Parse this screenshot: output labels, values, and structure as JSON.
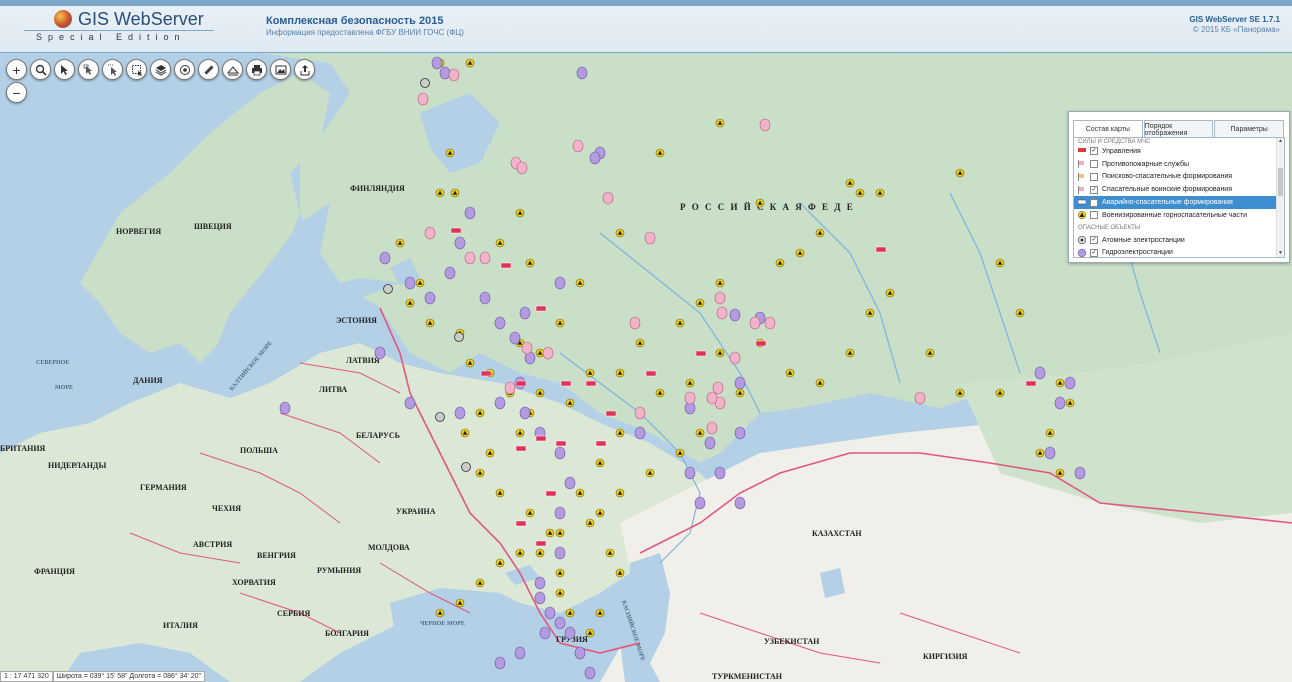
{
  "header": {
    "logo_title": "GIS WebServer",
    "logo_edition": "Special Edition",
    "center_title": "Комплексная безопасность 2015",
    "center_subtitle": "Информация предоставлена ФГБУ ВНИИ ГОЧС (ФЦ)",
    "right_title": "GIS WebServer SE 1.7.1",
    "right_subtitle": "© 2015 КБ «Панорама»"
  },
  "toolbar": {
    "buttons": [
      "zoom-in",
      "search",
      "select-pointer",
      "select-arrow",
      "select-area",
      "select-rect",
      "layers",
      "target",
      "ruler",
      "measure-area",
      "print",
      "export-image",
      "share"
    ],
    "zoom_in": "+",
    "zoom_out": "−"
  },
  "legend": {
    "tabs": [
      "Состав карты",
      "Порядок отображения",
      "Параметры"
    ],
    "active_tab": "Состав карты",
    "partial_top": "СИЛЫ И СРЕДСТВА МЧС",
    "rows": [
      {
        "label": "Управления",
        "checked": true,
        "icon": "flag-red-icon"
      },
      {
        "label": "Противопожарные службы",
        "checked": false,
        "icon": "flag-pink-icon"
      },
      {
        "label": "Поисково-спасательные формирования",
        "checked": false,
        "icon": "flag-orange-icon"
      },
      {
        "label": "Спасательные воинские формирования",
        "checked": true,
        "icon": "flag-pink-icon"
      },
      {
        "label": "Аварийно-спасательные формирования",
        "checked": false,
        "icon": "flag-white-icon",
        "selected": true
      },
      {
        "label": "Военизированные горноспасательные части",
        "checked": false,
        "icon": "warning-triangle-icon"
      }
    ],
    "section2": "ОПАСНЫЕ ОБЪЕКТЫ",
    "rows2": [
      {
        "label": "Атомные электростанции",
        "checked": true,
        "icon": "nuclear-icon"
      },
      {
        "label": "Гидроэлектростанции",
        "checked": true,
        "icon": "hydro-icon"
      }
    ]
  },
  "map_labels": [
    {
      "text": "ФИНЛЯНДИЯ"
    },
    {
      "text": "НОРВЕГИЯ"
    },
    {
      "text": "ШВЕЦИЯ"
    },
    {
      "text": "ЭСТОНИЯ"
    },
    {
      "text": "ЛАТВИЯ"
    },
    {
      "text": "ЛИТВА"
    },
    {
      "text": "ДАНИЯ"
    },
    {
      "text": "БЕЛАРУСЬ"
    },
    {
      "text": "ПОЛЬША"
    },
    {
      "text": "ГЕРМАНИЯ"
    },
    {
      "text": "НИДЕРЛАНДЫ"
    },
    {
      "text": "БРИТАНИЯ"
    },
    {
      "text": "ЧЕХИЯ"
    },
    {
      "text": "АВСТРИЯ"
    },
    {
      "text": "ВЕНГРИЯ"
    },
    {
      "text": "УКРАИНА"
    },
    {
      "text": "МОЛДОВА"
    },
    {
      "text": "РУМЫНИЯ"
    },
    {
      "text": "ФРАНЦИЯ"
    },
    {
      "text": "ХОРВАТИЯ"
    },
    {
      "text": "СЕРБИЯ"
    },
    {
      "text": "ИТАЛИЯ"
    },
    {
      "text": "БОЛГАРИЯ"
    },
    {
      "text": "ГРУЗИЯ"
    },
    {
      "text": "КАЗАХСТАН"
    },
    {
      "text": "УЗБЕКИСТАН"
    },
    {
      "text": "ТУРКМЕНИСТАН"
    },
    {
      "text": "КИРГИЗИЯ"
    },
    {
      "text": "Р О С С И Й С К А Я   Ф Е Д Е"
    },
    {
      "text": "СЕВЕРНОЕ"
    },
    {
      "text": "МОРЕ"
    },
    {
      "text": "ЧЕРНОЕ МОРЕ"
    },
    {
      "text": "КАСПИЙСКОЕ МОРЕ"
    },
    {
      "text": "БАЛТИЙСКОЕ МОРЕ"
    }
  ],
  "status": {
    "scale": "1 : 17 471 320",
    "coords": "Широта = 039° 15' 58\" Долгота = 086° 34' 20\""
  },
  "colors": {
    "sea": "#b3d0e6",
    "land_green": "#c9dfc7",
    "land_beige": "#f1efe9",
    "border_pink": "#e0577f",
    "panel_blue": "#3d8fd1",
    "marker_yellow": "#f2d21a",
    "marker_purple": "#b49be0",
    "marker_pink": "#e89ab8"
  }
}
